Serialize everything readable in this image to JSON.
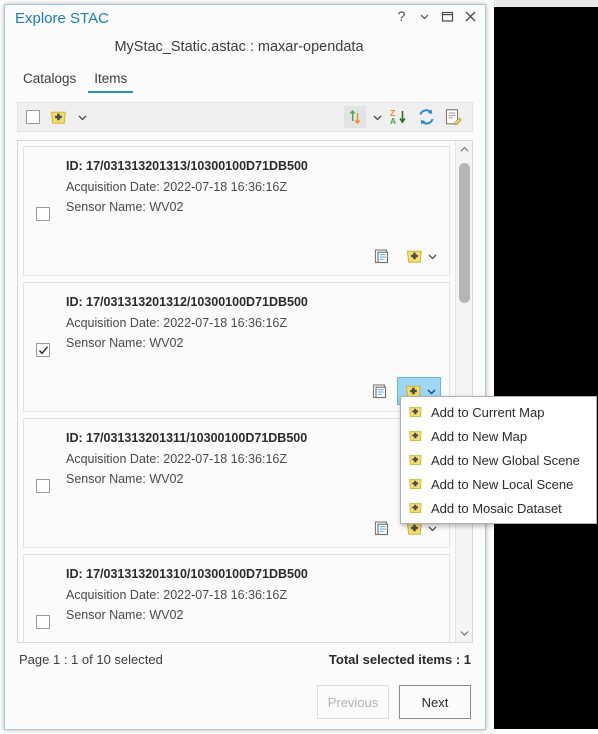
{
  "window": {
    "title": "Explore STAC",
    "subtitle": "MyStac_Static.astac : maxar-opendata",
    "controls": [
      {
        "name": "help-button",
        "glyph": "?"
      },
      {
        "name": "chevron-down-icon",
        "glyph": "⌄"
      },
      {
        "name": "maximize-button",
        "glyph": "□"
      },
      {
        "name": "close-button",
        "glyph": "✕"
      }
    ]
  },
  "tabs": [
    {
      "label": "Catalogs",
      "active": false
    },
    {
      "label": "Items",
      "active": true
    }
  ],
  "toolbar": {
    "select_all_checkbox": {
      "checked": false
    },
    "add_button_label": "Add",
    "icons": [
      "select-all-checkbox",
      "add-to-map-icon",
      "add-dropdown-caret-icon",
      "sort-direction-icon",
      "sort-dropdown-caret-icon",
      "sort-za-icon",
      "refresh-icon",
      "edit-metadata-icon"
    ]
  },
  "items": [
    {
      "id_label": "ID: 17/031313201313/10300100D71DB500",
      "acquisition_label": "Acquisition Date: 2022-07-18 16:36:16Z",
      "sensor_label": "Sensor Name: WV02",
      "checked": false,
      "add_menu_open": false
    },
    {
      "id_label": "ID: 17/031313201312/10300100D71DB500",
      "acquisition_label": "Acquisition Date: 2022-07-18 16:36:16Z",
      "sensor_label": "Sensor Name: WV02",
      "checked": true,
      "add_menu_open": true
    },
    {
      "id_label": "ID: 17/031313201311/10300100D71DB500",
      "acquisition_label": "Acquisition Date: 2022-07-18 16:36:16Z",
      "sensor_label": "Sensor Name: WV02",
      "checked": false,
      "add_menu_open": false
    },
    {
      "id_label": "ID: 17/031313201310/10300100D71DB500",
      "acquisition_label": "Acquisition Date: 2022-07-18 16:36:16Z",
      "sensor_label": "Sensor Name: WV02",
      "checked": false,
      "add_menu_open": false
    }
  ],
  "add_menu": {
    "items": [
      "Add to Current  Map",
      "Add to New Map",
      "Add to New Global Scene",
      "Add to New Local Scene",
      "Add to Mosaic Dataset"
    ]
  },
  "footer": {
    "page_status": "Page 1 : 1 of 10 selected",
    "total_selected": "Total selected items : 1",
    "previous_label": "Previous",
    "next_label": "Next",
    "previous_disabled": true
  },
  "colors": {
    "title_blue": "#1f7bbf",
    "tab_underline": "#2f8bcf",
    "accent_highlight": "#9fd6f5",
    "map_yellow": "#f2dd6e",
    "refresh_blue": "#2f8bcf",
    "sort_green": "#4ca64c",
    "sort_orange": "#e98b2a"
  }
}
